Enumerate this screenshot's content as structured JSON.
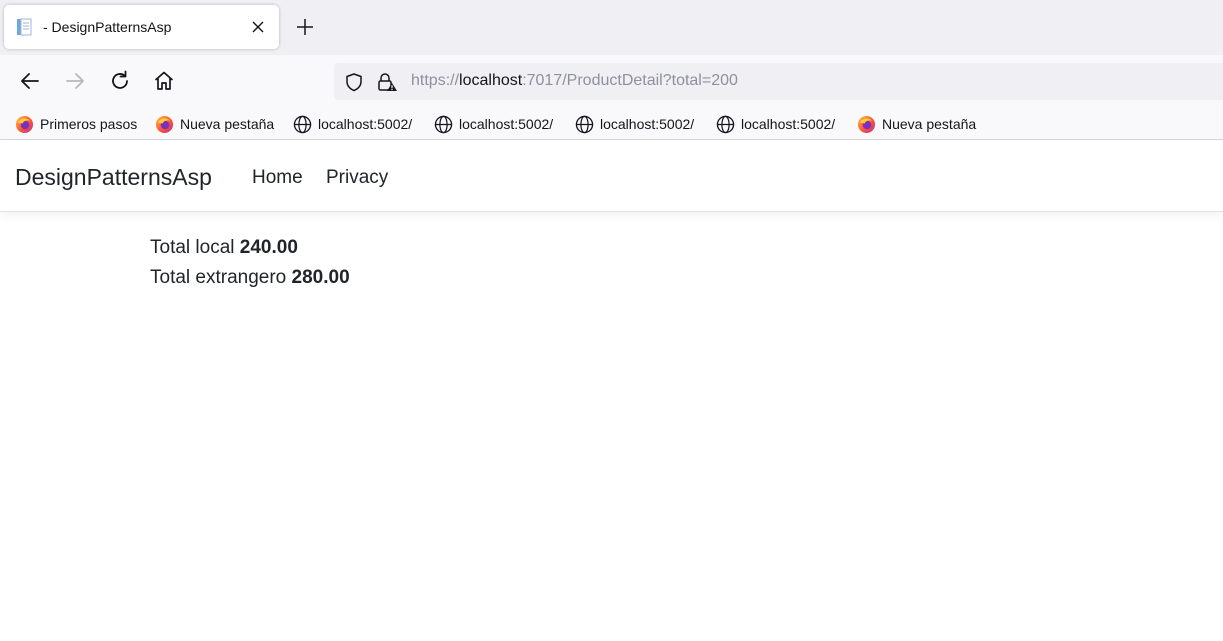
{
  "browser": {
    "tab": {
      "title": "- DesignPatternsAsp",
      "favicon": "document-icon"
    },
    "nav_icons": [
      "back-arrow-icon",
      "forward-arrow-icon",
      "reload-icon",
      "home-icon"
    ],
    "url": {
      "scheme": "https://",
      "host": "localhost",
      "rest": ":7017/ProductDetail?total=200"
    },
    "bookmarks": [
      {
        "label": "Primeros pasos",
        "icon": "firefox-icon"
      },
      {
        "label": "Nueva pestaña",
        "icon": "firefox-icon"
      },
      {
        "label": "localhost:5002/",
        "icon": "globe-icon"
      },
      {
        "label": "localhost:5002/",
        "icon": "globe-icon"
      },
      {
        "label": "localhost:5002/",
        "icon": "globe-icon"
      },
      {
        "label": "localhost:5002/",
        "icon": "globe-icon"
      },
      {
        "label": "Nueva pestaña",
        "icon": "firefox-icon"
      }
    ]
  },
  "site": {
    "brand": "DesignPatternsAsp",
    "links": [
      "Home",
      "Privacy"
    ]
  },
  "content": {
    "local_label": "Total local",
    "local_value": "240.00",
    "foreign_label": "Total extrangero",
    "foreign_value": "280.00"
  },
  "colors": {
    "text": "#212529",
    "chrome_text": "#15141a",
    "url_dim": "#8f8f9d",
    "tabstrip_bg": "#f0f0f4",
    "toolbar_bg": "#f9f9fb"
  }
}
